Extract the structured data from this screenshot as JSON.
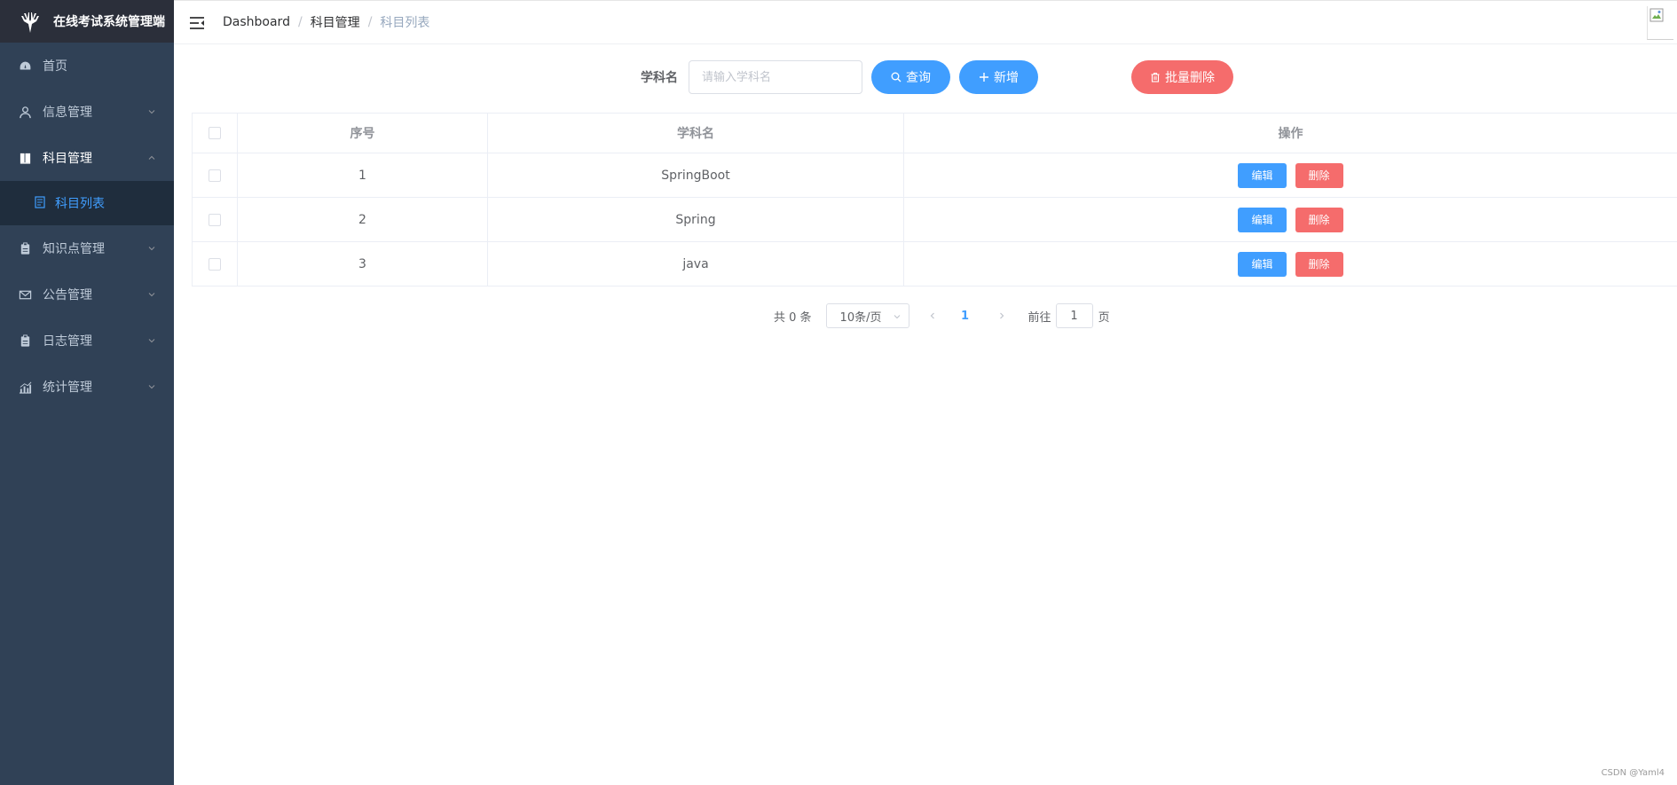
{
  "app": {
    "title": "在线考试系统管理端"
  },
  "sidebar": {
    "items": [
      {
        "label": "首页",
        "icon": "dashboard-icon"
      },
      {
        "label": "信息管理",
        "icon": "user-icon"
      },
      {
        "label": "科目管理",
        "icon": "book-icon"
      },
      {
        "label": "知识点管理",
        "icon": "clipboard-icon"
      },
      {
        "label": "公告管理",
        "icon": "mail-icon"
      },
      {
        "label": "日志管理",
        "icon": "clipboard-icon"
      },
      {
        "label": "统计管理",
        "icon": "chart-icon"
      }
    ],
    "subitem": {
      "label": "科目列表",
      "icon": "document-icon"
    }
  },
  "breadcrumb": [
    "Dashboard",
    "科目管理",
    "科目列表"
  ],
  "search": {
    "label": "学科名",
    "placeholder": "请输入学科名",
    "query_label": "查询",
    "add_label": "新增",
    "batch_delete_label": "批量删除"
  },
  "table": {
    "columns": [
      "序号",
      "学科名",
      "操作"
    ],
    "rows": [
      {
        "no": "1",
        "name": "SpringBoot"
      },
      {
        "no": "2",
        "name": "Spring"
      },
      {
        "no": "3",
        "name": "java"
      }
    ],
    "edit_label": "编辑",
    "delete_label": "删除"
  },
  "pagination": {
    "total": "共 0 条",
    "page_size": "10条/页",
    "current_page": "1",
    "goto_prefix": "前往",
    "goto_value": "1",
    "goto_suffix": "页"
  },
  "watermark": "CSDN @Yaml4",
  "colors": {
    "primary": "#409eff",
    "danger": "#f56c6c",
    "sidebar": "#304156",
    "logo_bg": "#2b2f3a"
  }
}
